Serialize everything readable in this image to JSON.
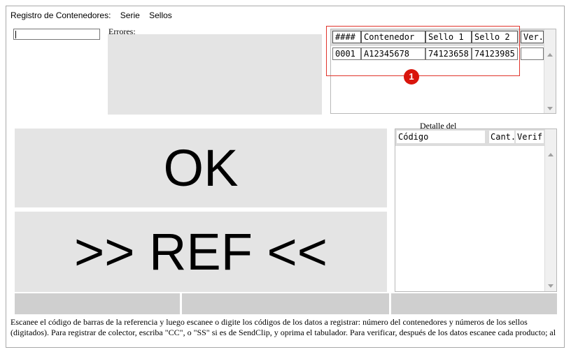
{
  "header": {
    "title": "Registro de Contenedores:",
    "serie": "Serie",
    "sellos": "Sellos"
  },
  "scan": {
    "value": ""
  },
  "errors": {
    "label": "Errores:"
  },
  "grid": {
    "headers": [
      "####",
      "Contenedor",
      "Sello 1",
      "Sello 2",
      "Ver."
    ],
    "rows": [
      [
        "0001",
        "A12345678",
        "74123658",
        "74123985",
        ""
      ]
    ]
  },
  "annotation": {
    "badge": "1",
    "color": "#d9150c"
  },
  "status": {
    "ok": "OK",
    "ref": ">> REF <<"
  },
  "detail": {
    "label": "Detalle del",
    "headers": [
      "Código",
      "Cant.",
      "Verif."
    ]
  },
  "instructions": "Escanee el código de barras de la referencia y luego escanee o digite los códigos de los datos a registrar: número del contenedores y números de los sellos (digitados). Para registrar de colector, escriba \"CC\", o \"SS\" si es de SendClip, y oprima el tabulador. Para verificar, después de los datos escanee cada producto; al"
}
